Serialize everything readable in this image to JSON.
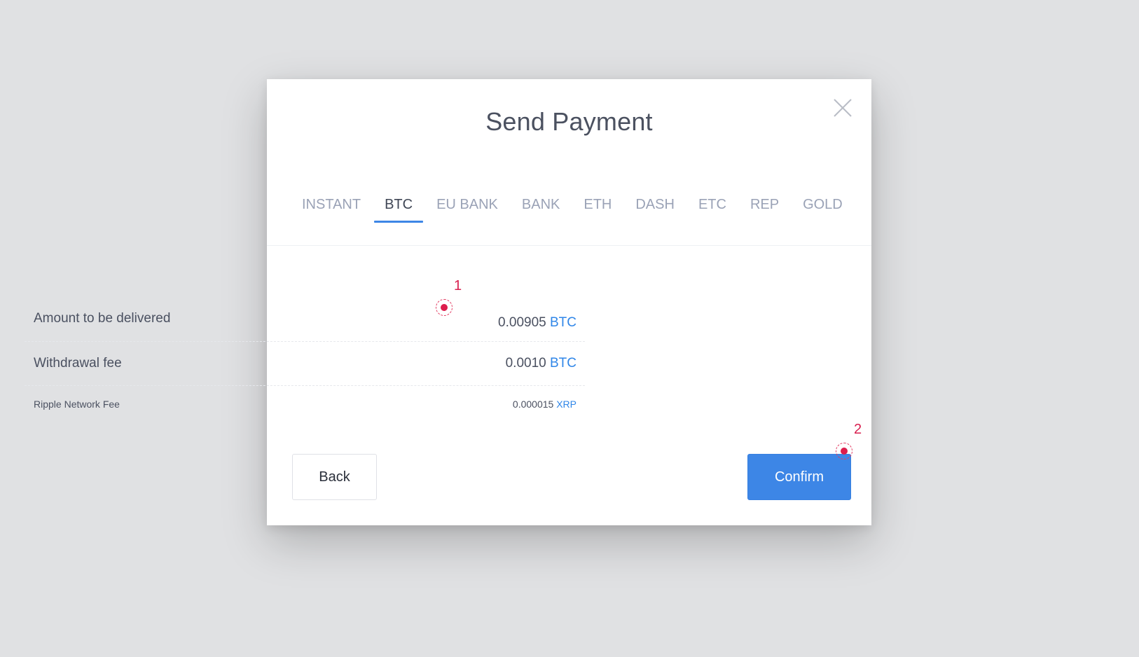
{
  "dialog": {
    "title": "Send Payment"
  },
  "tabs": [
    {
      "label": "INSTANT"
    },
    {
      "label": "BTC"
    },
    {
      "label": "EU BANK"
    },
    {
      "label": "BANK"
    },
    {
      "label": "ETH"
    },
    {
      "label": "DASH"
    },
    {
      "label": "ETC"
    },
    {
      "label": "REP"
    },
    {
      "label": "GOLD"
    }
  ],
  "active_tab": "BTC",
  "details": {
    "amount": {
      "label": "Amount to be delivered",
      "value": "0.00905",
      "unit": "BTC"
    },
    "withdrawal_fee": {
      "label": "Withdrawal fee",
      "value": "0.0010",
      "unit": "BTC"
    },
    "ripple_fee": {
      "label": "Ripple Network Fee",
      "value": "0.000015",
      "unit": "XRP"
    }
  },
  "buttons": {
    "back": "Back",
    "confirm": "Confirm"
  },
  "hotspots": {
    "one": "1",
    "two": "2"
  },
  "colors": {
    "accent": "#3d86e6",
    "hotspot": "#dd1e4d",
    "text": "#4a5060",
    "tab_inactive": "#9aa2b6"
  },
  "icons": {
    "close": "close-icon"
  }
}
